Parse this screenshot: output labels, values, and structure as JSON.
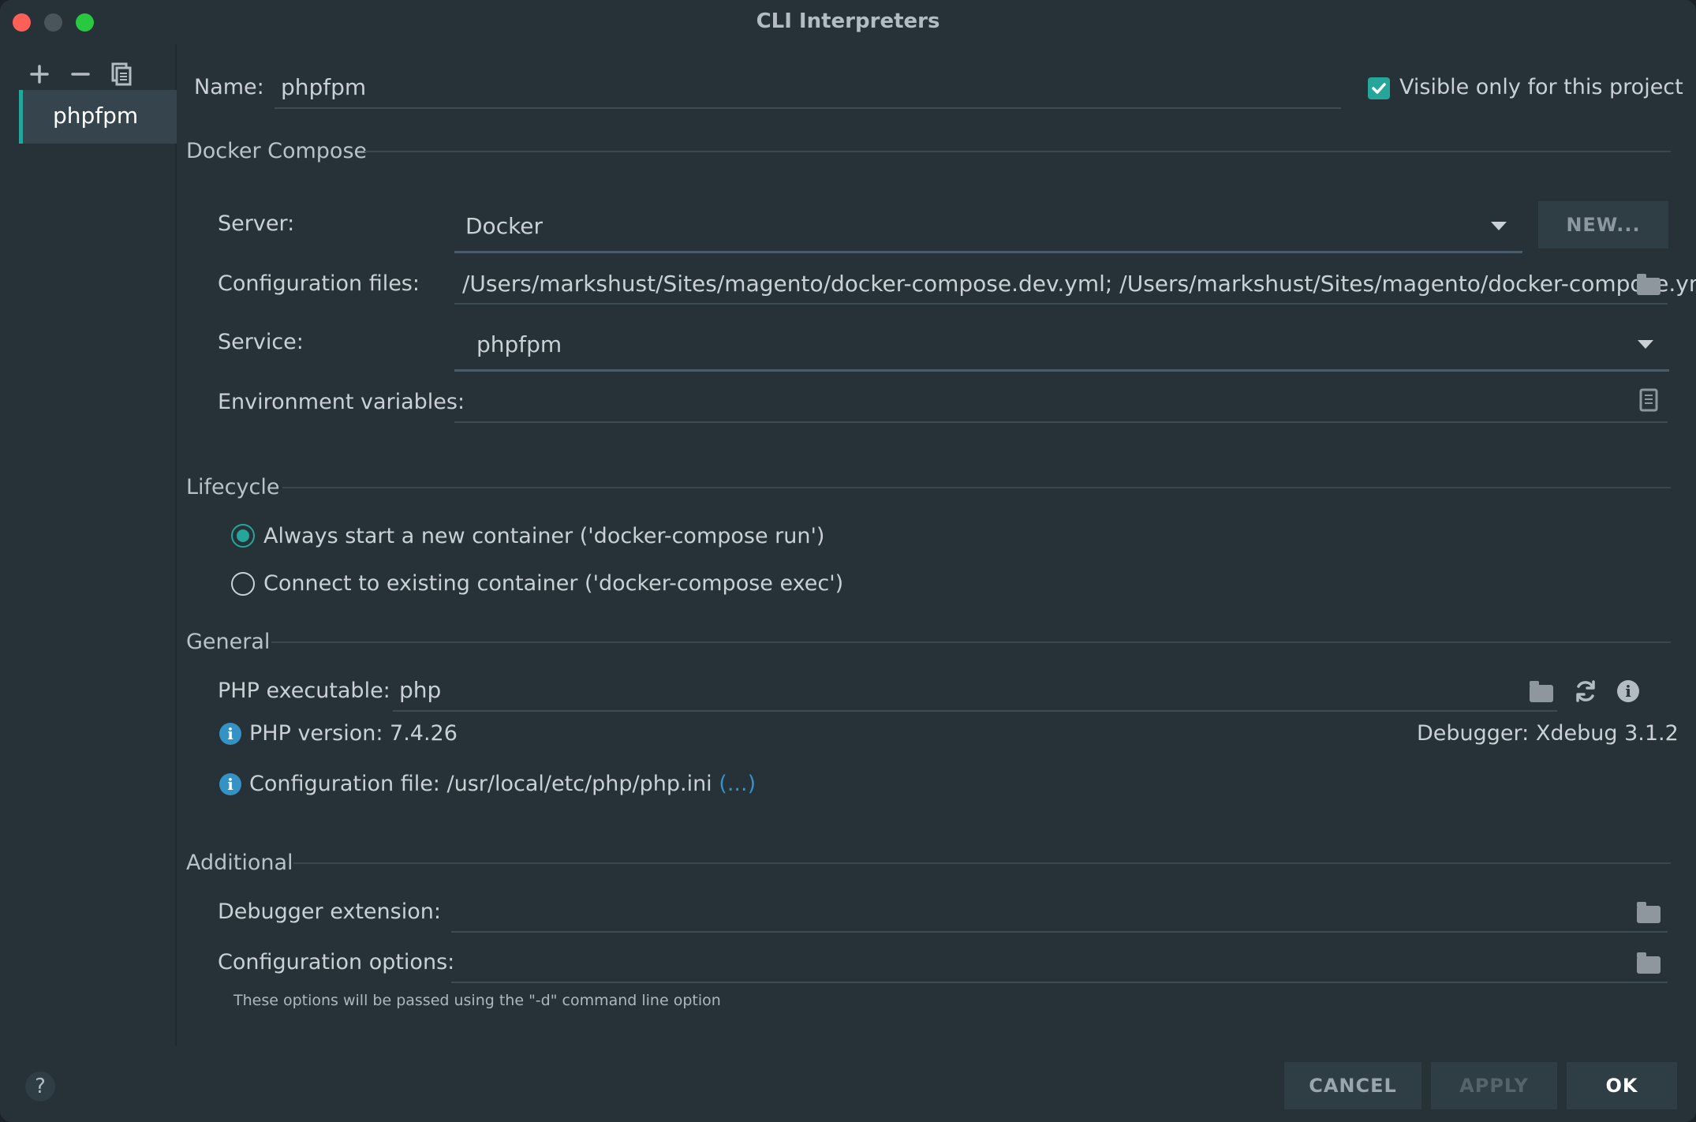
{
  "window": {
    "title": "CLI Interpreters"
  },
  "sidebar": {
    "items": [
      {
        "label": "phpfpm",
        "selected": true
      }
    ],
    "toolbar": {
      "add_icon": "plus-icon",
      "remove_icon": "minus-icon",
      "copy_icon": "copy-icon"
    }
  },
  "form": {
    "name_label": "Name:",
    "name_value": "phpfpm",
    "visible_checkbox_label": "Visible only for this project",
    "visible_checked": true
  },
  "docker_compose": {
    "section_title": "Docker Compose",
    "server_label": "Server:",
    "server_value": "Docker",
    "new_button": "NEW...",
    "config_files_label": "Configuration files:",
    "config_files_value": "/Users/markshust/Sites/magento/docker-compose.dev.yml; /Users/markshust/Sites/magento/docker-compose.yml",
    "service_label": "Service:",
    "service_value": "phpfpm",
    "env_vars_label": "Environment variables:",
    "env_vars_value": ""
  },
  "lifecycle": {
    "section_title": "Lifecycle",
    "options": [
      {
        "label": "Always start a new container ('docker-compose run')",
        "selected": true
      },
      {
        "label": "Connect to existing container ('docker-compose exec')",
        "selected": false
      }
    ]
  },
  "general": {
    "section_title": "General",
    "php_exec_label": "PHP executable:",
    "php_exec_value": "php",
    "php_version": "PHP version: 7.4.26",
    "debugger": "Debugger: Xdebug 3.1.2",
    "config_file": "Configuration file: /usr/local/etc/php/php.ini",
    "config_file_link": "(...)"
  },
  "additional": {
    "section_title": "Additional",
    "debugger_ext_label": "Debugger extension:",
    "config_options_label": "Configuration options:",
    "hint": "These options will be passed using the \"-d\" command line option"
  },
  "buttons": {
    "cancel": "CANCEL",
    "apply": "APPLY",
    "ok": "OK",
    "help": "?"
  },
  "colors": {
    "accent": "#26a69a",
    "background": "#263238",
    "info": "#3592c4",
    "link": "#3592c4"
  }
}
